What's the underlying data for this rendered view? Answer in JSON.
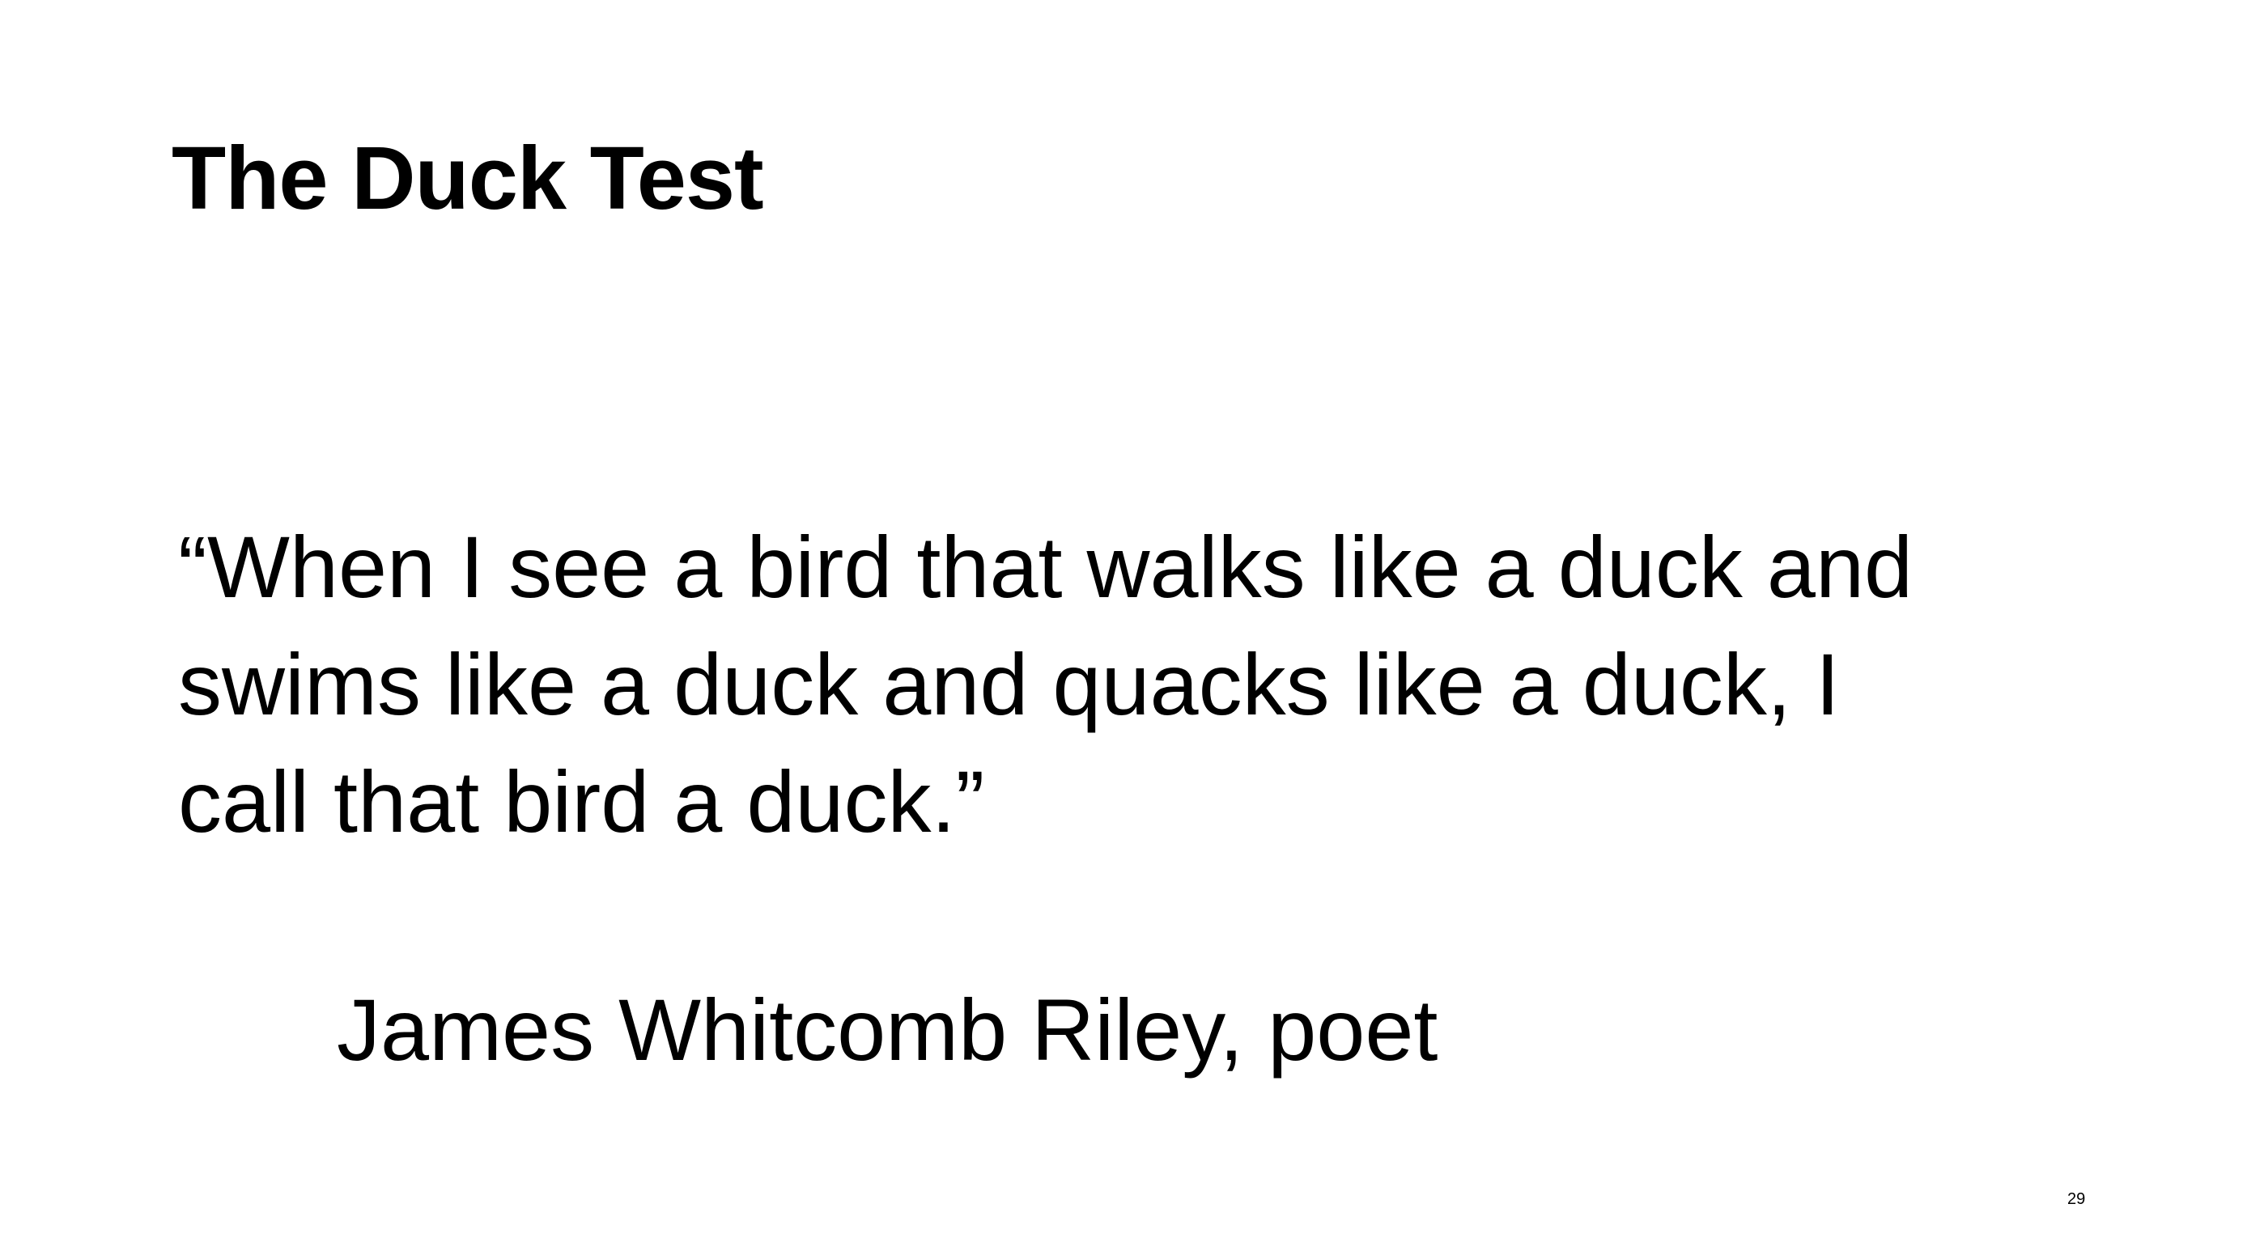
{
  "slide": {
    "title": "The Duck Test",
    "quote_lines": [
      "“When I see a bird that walks like a duck and",
      "swims like a duck and quacks like a duck, I",
      "call that bird a duck.”"
    ],
    "attribution": "James Whitcomb Riley, poet",
    "page_number": "29"
  },
  "colors": {
    "background": "#ffffff",
    "text": "#000000"
  }
}
